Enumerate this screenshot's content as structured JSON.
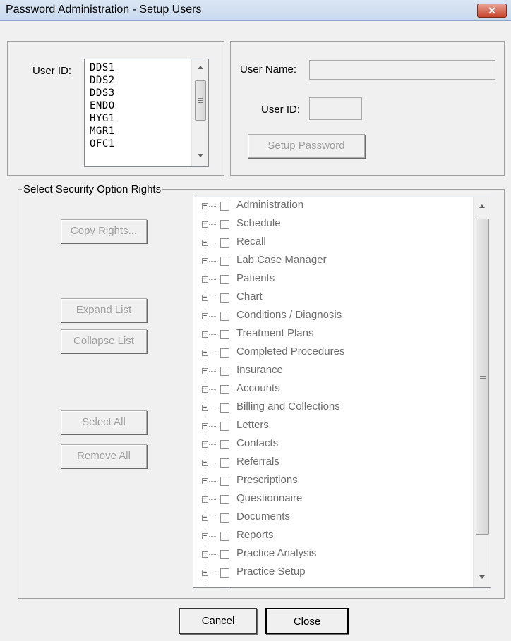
{
  "window": {
    "title": "Password Administration - Setup Users",
    "close_glyph": "✕"
  },
  "user_list": {
    "label": "User ID:",
    "items": [
      "DDS1",
      "DDS2",
      "DDS3",
      "ENDO",
      "HYG1",
      "MGR1",
      "OFC1"
    ]
  },
  "user_info": {
    "name_label": "User Name:",
    "name_value": "",
    "id_label": "User ID:",
    "id_value": "",
    "setup_password": "Setup Password"
  },
  "security": {
    "group_label": "Select Security Option Rights",
    "copy_rights": "Copy Rights...",
    "expand_list": "Expand List",
    "collapse_list": "Collapse List",
    "select_all": "Select All",
    "remove_all": "Remove All",
    "tree_items": [
      "Administration",
      "Schedule",
      "Recall",
      "Lab Case Manager",
      "Patients",
      "Chart",
      "Conditions / Diagnosis",
      "Treatment Plans",
      "Completed Procedures",
      "Insurance",
      "Accounts",
      "Billing and Collections",
      "Letters",
      "Contacts",
      "Referrals",
      "Prescriptions",
      "Questionnaire",
      "Documents",
      "Reports",
      "Practice Analysis",
      "Practice Setup"
    ]
  },
  "footer": {
    "cancel": "Cancel",
    "close": "Close"
  }
}
